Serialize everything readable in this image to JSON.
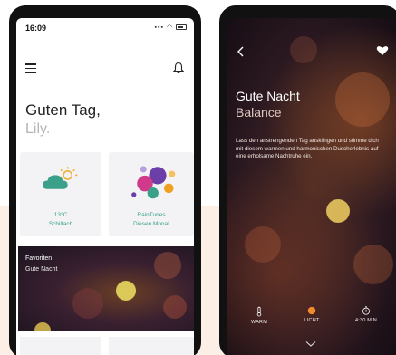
{
  "home": {
    "status_time": "16:09",
    "greeting": "Guten Tag,",
    "name": "Lily.",
    "weather_card": {
      "temp": "13°C",
      "condition": "Schiltach"
    },
    "raintunes_card": {
      "title": "RainTunes",
      "subtitle": "Diesen Monat"
    },
    "favorites_card": {
      "title": "Favoriten",
      "subtitle": "Gute Nacht"
    }
  },
  "detail": {
    "title": "Gute Nacht",
    "subtitle": "Balance",
    "description": "Lass den anstrengenden Tag ausklingen und stimme dich mit diesem warmen und harmonischen Duscherlebnis auf eine erholsame Nachtruhe ein.",
    "controls": [
      {
        "label": "WARM",
        "icon": "thermometer-icon"
      },
      {
        "label": "LICHT",
        "icon": "light-dot-icon"
      },
      {
        "label": "4:30 MIN",
        "icon": "timer-icon"
      }
    ]
  },
  "colors": {
    "accent": "#3aa08a",
    "light_orange": "#f08a2a"
  }
}
